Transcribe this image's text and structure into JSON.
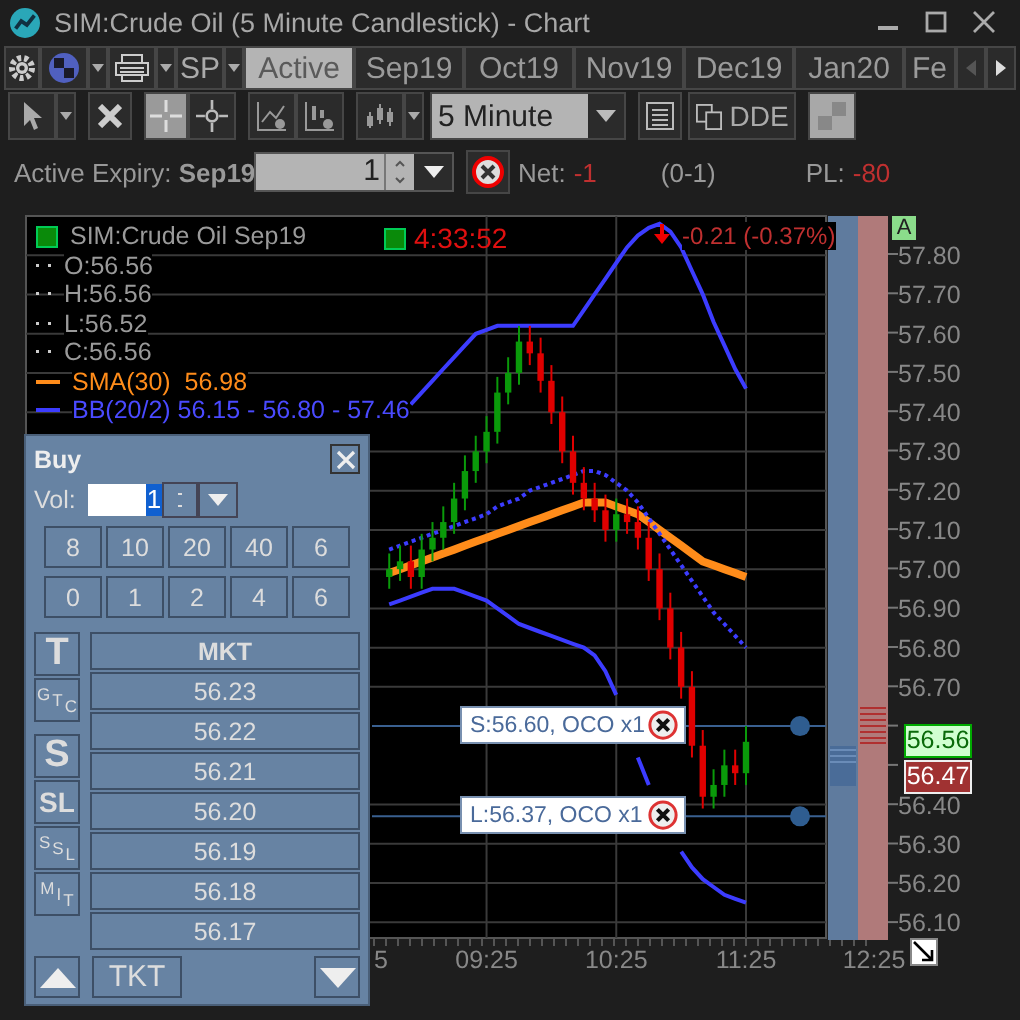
{
  "window": {
    "title": "SIM:Crude Oil (5 Minute Candlestick) - Chart"
  },
  "tab_bar": {
    "symbol_button": "SP",
    "tabs": [
      {
        "label": "Active",
        "selected": true
      },
      {
        "label": "Sep19",
        "selected": false
      },
      {
        "label": "Oct19",
        "selected": false
      },
      {
        "label": "Nov19",
        "selected": false
      },
      {
        "label": "Dec19",
        "selected": false
      },
      {
        "label": "Jan20",
        "selected": false
      },
      {
        "label": "Fe",
        "selected": false
      }
    ]
  },
  "toolbar": {
    "crosshair_on": true,
    "interval": "5 Minute",
    "dde_button": "DDE"
  },
  "expiry_bar": {
    "label": "Active Expiry: **Sep19**",
    "quantity": "1",
    "net_label": "Net:",
    "net_value": "-1",
    "position": "(0-1)",
    "pl_label": "PL:",
    "pl_value": "-80"
  },
  "chart": {
    "legend": {
      "symbol": "SIM:Crude Oil Sep19",
      "ohlc": [
        "O:56.56",
        "H:56.56",
        "L:56.52",
        "C:56.56"
      ],
      "sma": "SMA(30)  56.98",
      "bb": "BB(20/2) 56.15 - 56.80 - 57.46"
    },
    "timer": "4:33:52",
    "change": "-0.21 (-0.37%)",
    "orders": [
      {
        "label": "S:56.60, OCO x1"
      },
      {
        "label": "L:56.37, OCO x1"
      }
    ],
    "x_axis_fragment": "5",
    "x_axis_right": "12:25",
    "bid_tag": "56.56",
    "ask_tag": "56.47",
    "autoscale_button": "A",
    "chart_data": {
      "type": "candlestick",
      "x": [
        520,
        525,
        530,
        535,
        540,
        545,
        550,
        555,
        560,
        565,
        570,
        575,
        580,
        585,
        590,
        595,
        600,
        605,
        610,
        615,
        620,
        625,
        630,
        635,
        640,
        645,
        650,
        655,
        660,
        665,
        670,
        675,
        680,
        685
      ],
      "ohlc": [
        [
          56.98,
          57.04,
          56.95,
          57.0
        ],
        [
          57.0,
          57.06,
          56.97,
          57.02
        ],
        [
          57.02,
          57.06,
          56.95,
          56.98
        ],
        [
          56.98,
          57.09,
          56.95,
          57.05
        ],
        [
          57.05,
          57.12,
          57.02,
          57.08
        ],
        [
          57.08,
          57.16,
          57.05,
          57.12
        ],
        [
          57.12,
          57.22,
          57.09,
          57.18
        ],
        [
          57.18,
          57.29,
          57.15,
          57.25
        ],
        [
          57.25,
          57.34,
          57.22,
          57.3
        ],
        [
          57.3,
          57.39,
          57.27,
          57.35
        ],
        [
          57.35,
          57.49,
          57.32,
          57.45
        ],
        [
          57.45,
          57.54,
          57.42,
          57.5
        ],
        [
          57.5,
          57.62,
          57.47,
          57.58
        ],
        [
          57.58,
          57.62,
          57.52,
          57.55
        ],
        [
          57.55,
          57.59,
          57.45,
          57.48
        ],
        [
          57.48,
          57.52,
          57.37,
          57.4
        ],
        [
          57.4,
          57.44,
          57.27,
          57.3
        ],
        [
          57.3,
          57.34,
          57.19,
          57.22
        ],
        [
          57.22,
          57.26,
          57.15,
          57.18
        ],
        [
          57.18,
          57.22,
          57.12,
          57.15
        ],
        [
          57.15,
          57.19,
          57.07,
          57.1
        ],
        [
          57.1,
          57.18,
          57.07,
          57.14
        ],
        [
          57.14,
          57.18,
          57.09,
          57.12
        ],
        [
          57.12,
          57.16,
          57.05,
          57.08
        ],
        [
          57.08,
          57.12,
          56.97,
          57.0
        ],
        [
          57.0,
          57.04,
          56.87,
          56.9
        ],
        [
          56.9,
          56.94,
          56.77,
          56.8
        ],
        [
          56.8,
          56.84,
          56.67,
          56.7
        ],
        [
          56.7,
          56.74,
          56.52,
          56.55
        ],
        [
          56.55,
          56.59,
          56.39,
          56.42
        ],
        [
          56.42,
          56.49,
          56.39,
          56.45
        ],
        [
          56.45,
          56.54,
          56.42,
          56.5
        ],
        [
          56.5,
          56.54,
          56.45,
          56.48
        ],
        [
          56.48,
          56.6,
          56.45,
          56.56
        ]
      ],
      "series": [
        {
          "type": "line",
          "color": "#ff8c1a",
          "values": [
            56.99,
            57.0,
            57.01,
            57.02,
            57.03,
            57.04,
            57.05,
            57.06,
            57.07,
            57.08,
            57.09,
            57.1,
            57.11,
            57.12,
            57.13,
            57.14,
            57.15,
            57.16,
            57.17,
            57.17,
            57.17,
            57.16,
            57.15,
            57.14,
            57.12,
            57.1,
            57.08,
            57.06,
            57.04,
            57.02,
            57.01,
            57.0,
            56.99,
            56.98
          ]
        },
        {
          "type": "line",
          "color": "#3c3cff",
          "values": [
            null,
            null,
            57.42,
            57.45,
            57.48,
            57.51,
            57.54,
            57.57,
            57.6,
            57.61,
            57.62,
            57.62,
            57.62,
            57.62,
            57.62,
            57.62,
            57.62,
            57.62,
            57.66,
            57.7,
            57.74,
            57.78,
            57.82,
            57.85,
            57.87,
            57.88,
            57.86,
            57.82,
            57.76,
            57.7,
            57.63,
            57.57,
            57.51,
            57.46
          ]
        },
        {
          "type": "line",
          "line_style": "dashed",
          "color": "#3c3cff",
          "values": [
            57.05,
            57.06,
            57.07,
            57.08,
            57.09,
            57.1,
            57.11,
            57.12,
            57.13,
            57.14,
            57.16,
            57.17,
            57.18,
            57.2,
            57.21,
            57.22,
            57.23,
            57.24,
            57.25,
            57.25,
            57.24,
            57.22,
            57.2,
            57.17,
            57.13,
            57.09,
            57.05,
            57.01,
            56.97,
            56.93,
            56.89,
            56.86,
            56.83,
            56.8
          ]
        },
        {
          "type": "line",
          "color": "#3c3cff",
          "values": [
            56.91,
            56.92,
            56.93,
            56.94,
            56.95,
            56.95,
            56.95,
            56.94,
            56.93,
            56.92,
            56.9,
            56.88,
            56.86,
            56.85,
            56.84,
            56.83,
            56.82,
            56.81,
            56.8,
            56.78,
            56.74,
            56.68,
            null,
            56.52,
            56.45,
            null,
            null,
            56.28,
            56.24,
            56.21,
            56.19,
            56.17,
            56.16,
            56.15
          ]
        }
      ],
      "xlim": [
        352,
        722
      ],
      "ylim": [
        56.06,
        57.9
      ],
      "grid": true,
      "ref_lines": [
        {
          "axis": "y",
          "value": 56.6
        },
        {
          "axis": "y",
          "value": 56.37
        }
      ],
      "xticks": [
        {
          "value": 565,
          "label": "09:25"
        },
        {
          "value": 625,
          "label": "10:25"
        },
        {
          "value": 685,
          "label": "11:25"
        }
      ],
      "yticks": [
        {
          "value": 57.8,
          "label": "57.80"
        },
        {
          "value": 57.7,
          "label": "57.70"
        },
        {
          "value": 57.6,
          "label": "57.60"
        },
        {
          "value": 57.5,
          "label": "57.50"
        },
        {
          "value": 57.4,
          "label": "57.40"
        },
        {
          "value": 57.3,
          "label": "57.30"
        },
        {
          "value": 57.2,
          "label": "57.20"
        },
        {
          "value": 57.1,
          "label": "57.10"
        },
        {
          "value": 57.0,
          "label": "57.00"
        },
        {
          "value": 56.9,
          "label": "56.90"
        },
        {
          "value": 56.8,
          "label": "56.80"
        },
        {
          "value": 56.7,
          "label": "56.70"
        },
        {
          "value": 56.4,
          "label": "56.40"
        },
        {
          "value": 56.3,
          "label": "56.30"
        },
        {
          "value": 56.2,
          "label": "56.20"
        },
        {
          "value": 56.1,
          "label": "56.10"
        }
      ]
    }
  },
  "order_panel": {
    "title": "Buy",
    "vol_label": "Vol:",
    "volume": "1",
    "quick_sizes": [
      [
        "8",
        "10",
        "20",
        "40",
        "6"
      ],
      [
        "0",
        "1",
        "2",
        "4",
        "6"
      ]
    ],
    "order_types": [
      {
        "label": "T",
        "kind": "big"
      },
      {
        "label": "GTC",
        "kind": "stagger"
      },
      {
        "label": "S",
        "kind": "big"
      },
      {
        "label": "SL",
        "kind": "bold"
      },
      {
        "label": "SSL",
        "kind": "stagger"
      },
      {
        "label": "MIT",
        "kind": "stagger"
      }
    ],
    "ladder_header": "MKT",
    "prices": [
      "56.23",
      "56.22",
      "56.21",
      "56.20",
      "56.19",
      "56.18",
      "56.17"
    ],
    "ticket_button": "TKT"
  }
}
